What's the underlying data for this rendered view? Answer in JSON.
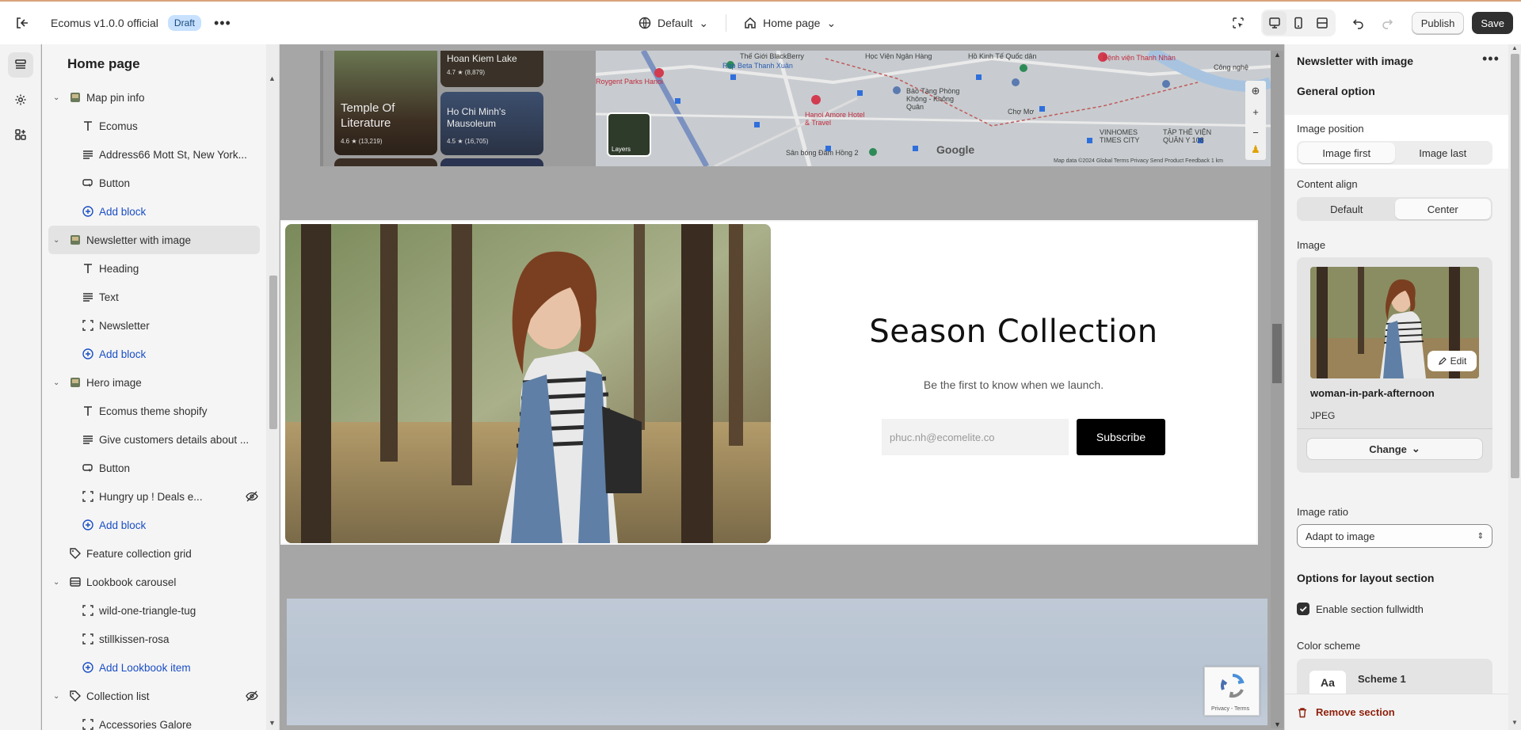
{
  "topbar": {
    "store_title": "Ecomus v1.0.0 official",
    "status_badge": "Draft",
    "theme_dropdown": "Default",
    "page_dropdown": "Home page",
    "publish_label": "Publish",
    "save_label": "Save"
  },
  "sidebar": {
    "title": "Home page",
    "items": [
      {
        "label": "Map pin info",
        "icon": "section-image-icon",
        "kind": "section"
      },
      {
        "label": "Ecomus",
        "icon": "text-icon",
        "kind": "child"
      },
      {
        "label": "Address66 Mott St, New York...",
        "icon": "paragraph-icon",
        "kind": "child"
      },
      {
        "label": "Button",
        "icon": "button-icon",
        "kind": "child"
      },
      {
        "label": "Add block",
        "icon": "plus-circle-icon",
        "kind": "add"
      },
      {
        "label": "Newsletter with image",
        "icon": "section-image-icon",
        "kind": "section-selected"
      },
      {
        "label": "Heading",
        "icon": "text-icon",
        "kind": "child"
      },
      {
        "label": "Text",
        "icon": "paragraph-icon",
        "kind": "child"
      },
      {
        "label": "Newsletter",
        "icon": "block-icon",
        "kind": "child"
      },
      {
        "label": "Add block",
        "icon": "plus-circle-icon",
        "kind": "add"
      },
      {
        "label": "Hero image",
        "icon": "section-image-icon",
        "kind": "section"
      },
      {
        "label": "Ecomus theme shopify",
        "icon": "text-icon",
        "kind": "child"
      },
      {
        "label": "Give customers details about ...",
        "icon": "paragraph-icon",
        "kind": "child"
      },
      {
        "label": "Button",
        "icon": "button-icon",
        "kind": "child"
      },
      {
        "label": "Hungry up ! Deals e...",
        "icon": "block-icon",
        "kind": "child-hidden"
      },
      {
        "label": "Add block",
        "icon": "plus-circle-icon",
        "kind": "add"
      },
      {
        "label": "Feature collection grid",
        "icon": "tag-icon",
        "kind": "section-noexpand"
      },
      {
        "label": "Lookbook carousel",
        "icon": "carousel-icon",
        "kind": "section"
      },
      {
        "label": "wild-one-triangle-tug",
        "icon": "block-icon",
        "kind": "child"
      },
      {
        "label": "stillkissen-rosa",
        "icon": "block-icon",
        "kind": "child"
      },
      {
        "label": "Add Lookbook item",
        "icon": "plus-circle-icon",
        "kind": "add"
      },
      {
        "label": "Collection list",
        "icon": "tag-icon",
        "kind": "section-hidden"
      },
      {
        "label": "Accessories Galore",
        "icon": "block-icon",
        "kind": "child"
      }
    ]
  },
  "canvas": {
    "cards": [
      {
        "name": "Hoan Kiem Lake",
        "rating": "4.7 ★ (8,879)"
      },
      {
        "name": "Temple Of Literature",
        "rating": "4.6 ★ (13,219)"
      },
      {
        "name": "Ho Chi Minh's Mausoleum",
        "rating": "4.5 ★ (16,705)"
      }
    ],
    "map": {
      "labels": [
        "Thế Giới BlackBerry",
        "Học Viện Ngân Hàng",
        "Hồ Kinh Tế Quốc dân",
        "Bệnh viện Thanh Nhàn",
        "Công nghệ",
        "Rap Beta Thanh Xuân",
        "Roygent Parks Hanoi",
        "Bảo Tàng Phòng Không - Không Quân",
        "Hanoi Amore Hotel & Travel",
        "VINHOMES TIMES CITY",
        "TẬP THỂ VIỆN QUÂN Y 108",
        "Chợ Mơ",
        "Sân bóng Đầm Hồng 2"
      ],
      "layers_label": "Layers",
      "google": "Google",
      "footer": "Map data ©2024  Global  Terms  Privacy  Send Product Feedback  1 km"
    },
    "newsletter": {
      "heading": "Season Collection",
      "text": "Be the first to know when we launch.",
      "email_value": "phuc.nh@ecomelite.co",
      "subscribe_label": "Subscribe"
    },
    "captcha": "Privacy - Terms"
  },
  "panel": {
    "title": "Newsletter with image",
    "general_heading": "General option",
    "image_position": {
      "label": "Image position",
      "options": [
        "Image first",
        "Image last"
      ],
      "selected": "Image first"
    },
    "content_align": {
      "label": "Content align",
      "options": [
        "Default",
        "Center"
      ],
      "selected": "Center"
    },
    "image": {
      "label": "Image",
      "edit_label": "Edit",
      "filename": "woman-in-park-afternoon",
      "type": "JPEG",
      "change_label": "Change"
    },
    "image_ratio": {
      "label": "Image ratio",
      "value": "Adapt to image"
    },
    "layout_heading": "Options for layout section",
    "fullwidth_label": "Enable section fullwidth",
    "fullwidth_checked": true,
    "color_scheme": {
      "label": "Color scheme",
      "sample": "Aa",
      "name": "Scheme 1"
    },
    "remove_label": "Remove section"
  }
}
